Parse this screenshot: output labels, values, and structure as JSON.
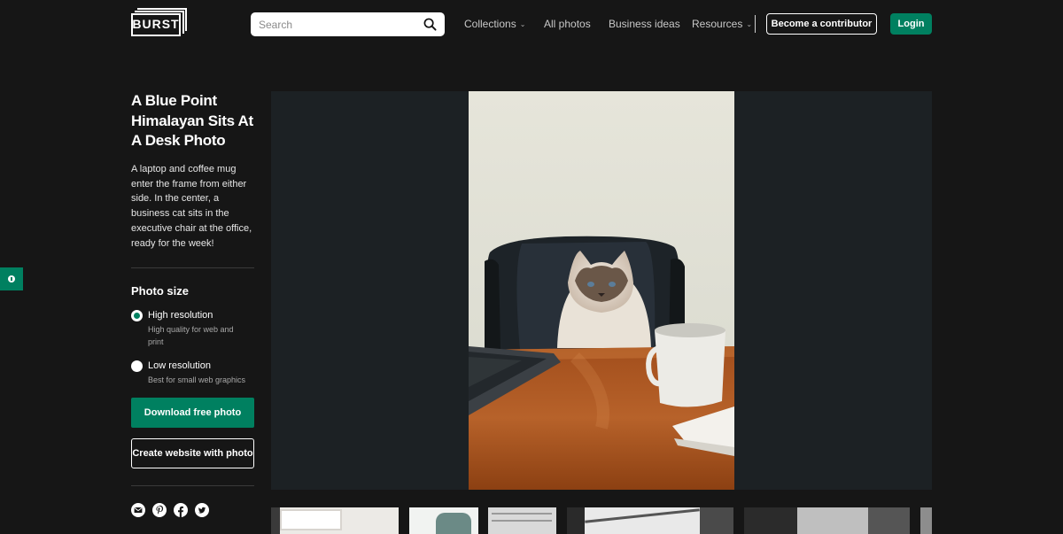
{
  "header": {
    "logo_text": "BURST",
    "search_placeholder": "Search",
    "nav": [
      {
        "label": "Collections",
        "has_dropdown": true
      },
      {
        "label": "All photos",
        "has_dropdown": false
      },
      {
        "label": "Business ideas",
        "has_dropdown": false
      },
      {
        "label": "Resources",
        "has_dropdown": true
      }
    ],
    "contributor_label": "Become a contributor",
    "login_label": "Login"
  },
  "photo": {
    "title": "A Blue Point Himalayan Sits At A Desk Photo",
    "description": "A laptop and coffee mug enter the frame from either side. In the center, a business cat sits in the executive chair at the office, ready for the week!"
  },
  "photo_size": {
    "heading": "Photo size",
    "options": [
      {
        "label": "High resolution",
        "sublabel": "High quality for web and print",
        "selected": true
      },
      {
        "label": "Low resolution",
        "sublabel": "Best for small web graphics",
        "selected": false
      }
    ]
  },
  "actions": {
    "download_label": "Download free photo",
    "create_site_label": "Create website with photo"
  },
  "social": [
    "email-icon",
    "pinterest-icon",
    "facebook-icon",
    "twitter-icon"
  ],
  "colors": {
    "background": "#161616",
    "accent": "#008060",
    "viewer_bg": "#1c2124"
  }
}
